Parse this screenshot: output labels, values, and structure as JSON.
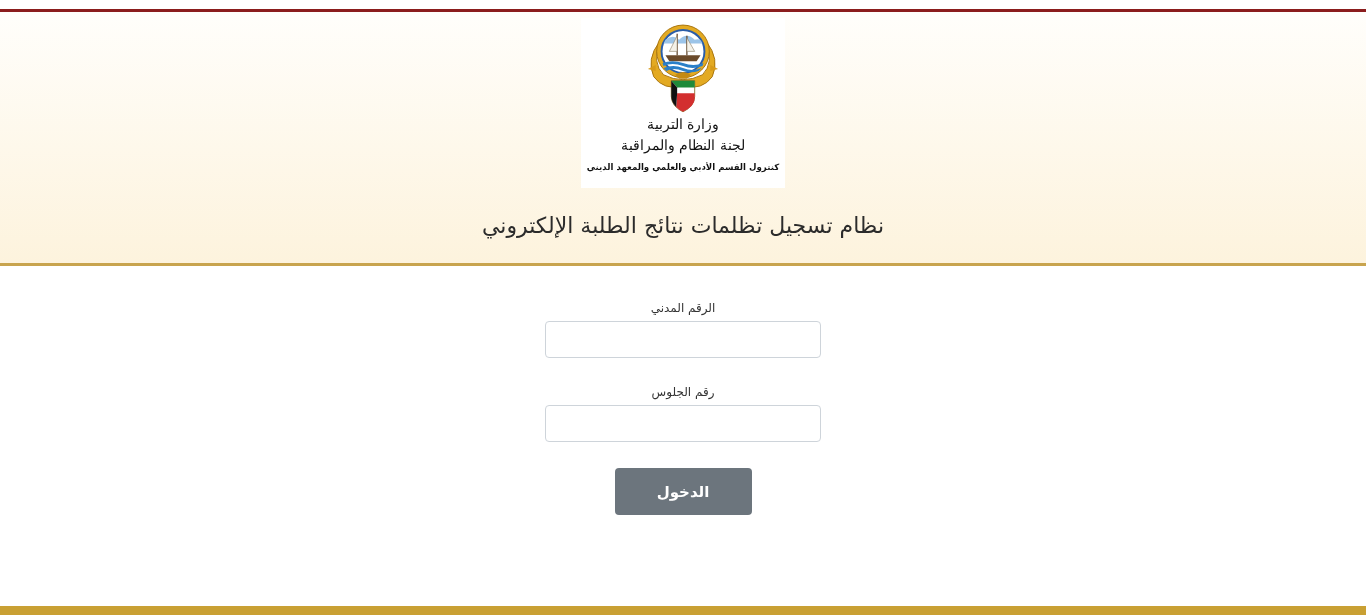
{
  "header": {
    "logo": {
      "lines": [
        {
          "kind": "ministry",
          "text": "وزارة التربية"
        },
        {
          "kind": "committee",
          "text": "لجنة النظام والمراقبة"
        },
        {
          "kind": "department",
          "text": "كنترول القسم الأدبي والعلمي والمعهد الديني"
        }
      ]
    },
    "title": "نظام تسجيل تظلمات نتائج الطلبة الإلكتروني"
  },
  "form": {
    "fields": [
      {
        "label": "الرقم المدني"
      },
      {
        "label": "رقم الجلوس"
      }
    ],
    "submit": "الدخول"
  }
}
